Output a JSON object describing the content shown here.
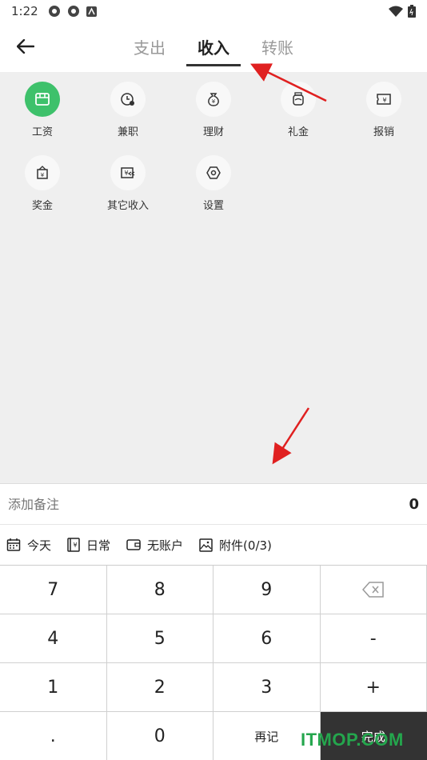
{
  "status_bar": {
    "time": "1:22"
  },
  "header": {
    "tabs": [
      {
        "label": "支出",
        "active": false
      },
      {
        "label": "收入",
        "active": true
      },
      {
        "label": "转账",
        "active": false
      }
    ]
  },
  "categories": [
    {
      "label": "工资",
      "icon": "wallet-icon",
      "selected": true
    },
    {
      "label": "兼职",
      "icon": "clock-icon",
      "selected": false
    },
    {
      "label": "理财",
      "icon": "money-bag-icon",
      "selected": false
    },
    {
      "label": "礼金",
      "icon": "gift-jar-icon",
      "selected": false
    },
    {
      "label": "报销",
      "icon": "receipt-icon",
      "selected": false
    },
    {
      "label": "奖金",
      "icon": "bonus-icon",
      "selected": false
    },
    {
      "label": "其它收入",
      "icon": "other-income-icon",
      "selected": false
    },
    {
      "label": "设置",
      "icon": "settings-icon",
      "selected": false
    }
  ],
  "note": {
    "placeholder": "添加备注",
    "amount": "0"
  },
  "options": {
    "date": "今天",
    "category": "日常",
    "account": "无账户",
    "attachment": "附件(0/3)"
  },
  "keypad": {
    "k7": "7",
    "k8": "8",
    "k9": "9",
    "k4": "4",
    "k5": "5",
    "k6": "6",
    "minus": "-",
    "k1": "1",
    "k2": "2",
    "k3": "3",
    "plus": "+",
    "dot": ".",
    "k0": "0",
    "again": "再记",
    "done": "完成"
  },
  "watermark": "ITMOP.COM",
  "colors": {
    "accent": "#3ec16b",
    "annotation_arrow": "#e02020",
    "done_key": "#333333"
  }
}
